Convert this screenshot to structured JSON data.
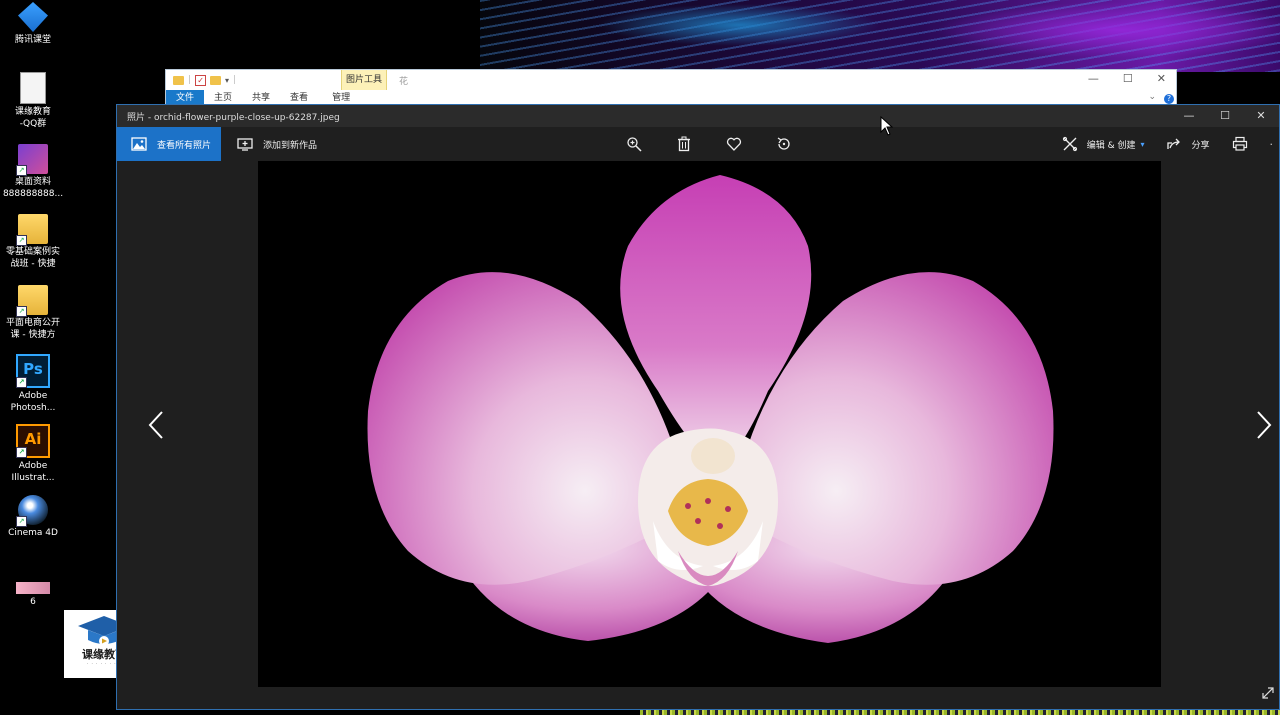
{
  "desktop": {
    "icons": [
      {
        "label": "腾讯课堂",
        "icon": "tencent-classroom-icon"
      },
      {
        "label": "课缘教育\n-QQ群",
        "icon": "text-document-icon"
      },
      {
        "label": "桌面资料\n888888888...",
        "icon": "media-file-icon"
      },
      {
        "label": "零基础案例实\n战班 - 快捷",
        "icon": "folder-icon"
      },
      {
        "label": "平面电商公开\n课 - 快捷方",
        "icon": "folder-icon"
      },
      {
        "label": "Adobe\nPhotosh...",
        "icon": "photoshop-icon"
      },
      {
        "label": "Adobe\nIllustrat...",
        "icon": "illustrator-icon"
      },
      {
        "label": "Cinema 4D",
        "icon": "cinema4d-icon"
      },
      {
        "label": "6",
        "icon": "image-thumbnail-icon"
      }
    ],
    "logo": {
      "name": "课缘教育"
    }
  },
  "explorer": {
    "tools_tab": "图片工具",
    "folder_name": "花",
    "ribbon_tabs": [
      "文件",
      "主页",
      "共享",
      "查看"
    ],
    "manage_tab": "管理"
  },
  "photos": {
    "title": "照片 - orchid-flower-purple-close-up-62287.jpeg",
    "toolbar": {
      "view_all": "查看所有照片",
      "add_to_creation": "添加到新作品",
      "edit_create": "编辑 & 创建",
      "share": "分享"
    },
    "accent_color": "#1c72c8"
  }
}
